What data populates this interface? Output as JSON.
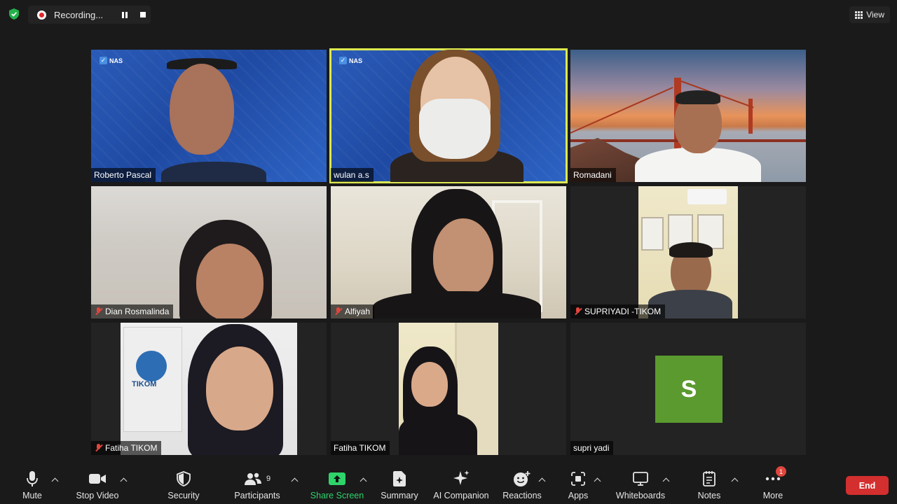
{
  "recording": {
    "label": "Recording..."
  },
  "view": {
    "label": "View"
  },
  "participants": [
    {
      "name": "Roberto Pascal",
      "muted": false,
      "brand": "NAS"
    },
    {
      "name": "wulan a.s",
      "muted": false,
      "brand": "NAS",
      "active_speaker": true
    },
    {
      "name": "Romadani",
      "muted": false
    },
    {
      "name": "Dian Rosmalinda",
      "muted": true
    },
    {
      "name": "Alfiyah",
      "muted": true
    },
    {
      "name": "SUPRIYADI -TIKOM",
      "muted": true
    },
    {
      "name": "Fatiha TIKOM",
      "muted": true
    },
    {
      "name": "Fatiha TIKOM",
      "muted": false
    },
    {
      "name": "supri yadi",
      "muted": false,
      "avatar_letter": "S",
      "avatar_color": "#5b9a2f"
    }
  ],
  "toolbar": {
    "mute": "Mute",
    "stop_video": "Stop Video",
    "security": "Security",
    "participants": "Participants",
    "participant_count": "9",
    "share_screen": "Share Screen",
    "summary": "Summary",
    "ai_companion": "AI Companion",
    "reactions": "Reactions",
    "apps": "Apps",
    "whiteboards": "Whiteboards",
    "notes": "Notes",
    "more": "More",
    "more_badge": "1",
    "end": "End"
  },
  "colors": {
    "active_speaker": "#dde94f",
    "share_green": "#2ed36a",
    "end_red": "#d32f2f"
  }
}
